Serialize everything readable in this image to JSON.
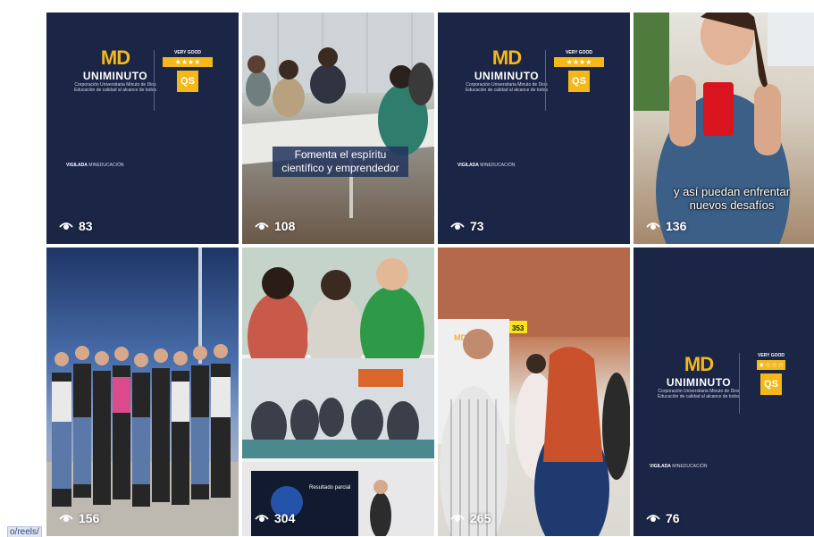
{
  "reels": [
    {
      "views": "83"
    },
    {
      "views": "108",
      "caption": "Fomenta el espíritu científico y emprendedor"
    },
    {
      "views": "73"
    },
    {
      "views": "136",
      "caption": "y así puedan enfrentar nuevos desafíos"
    },
    {
      "views": "156"
    },
    {
      "views": "304"
    },
    {
      "views": "265"
    },
    {
      "views": "76"
    }
  ],
  "brand": {
    "logo": "MD",
    "name": "UNIMINUTO",
    "subtitle_1": "Corporación Universitaria Minuto de Dios",
    "subtitle_2": "Educación de calidad al alcance de todos",
    "rating_label": "VERY GOOD",
    "stars": "★★★★",
    "stars_small": "★☆☆☆",
    "qs": "QS",
    "vigilada": "VIGILADA",
    "mineducacion": "MINEDUCACIÓN"
  },
  "photo_text": {
    "sign": "353",
    "sign_logo": "MD",
    "slide_title": "Resultado parcial"
  },
  "status_url": "o/reels/",
  "colors": {
    "brand_bg": "#1b2546",
    "brand_gold": "#f5b81a"
  },
  "icon": "eye-icon"
}
